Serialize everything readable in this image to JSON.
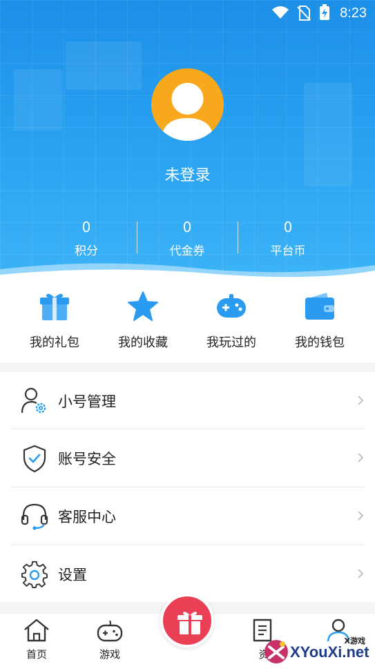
{
  "status_bar": {
    "time": "8:23"
  },
  "profile": {
    "login_status": "未登录"
  },
  "stats": [
    {
      "value": "0",
      "label": "积分"
    },
    {
      "value": "0",
      "label": "代金券"
    },
    {
      "value": "0",
      "label": "平台币"
    }
  ],
  "quick_actions": [
    {
      "label": "我的礼包",
      "icon": "gift-icon"
    },
    {
      "label": "我的收藏",
      "icon": "star-icon"
    },
    {
      "label": "我玩过的",
      "icon": "gamepad-icon"
    },
    {
      "label": "我的钱包",
      "icon": "wallet-icon"
    }
  ],
  "menu": [
    {
      "label": "小号管理",
      "icon": "account-settings-icon"
    },
    {
      "label": "账号安全",
      "icon": "shield-check-icon"
    },
    {
      "label": "客服中心",
      "icon": "headset-icon"
    },
    {
      "label": "设置",
      "icon": "gear-icon"
    }
  ],
  "bottom_nav": [
    {
      "label": "首页",
      "icon": "home-icon"
    },
    {
      "label": "游戏",
      "icon": "controller-icon"
    },
    {
      "label": "",
      "icon": "gift-icon"
    },
    {
      "label": "资",
      "icon": "document-icon"
    },
    {
      "label": "",
      "icon": "profile-icon"
    }
  ],
  "watermark": {
    "small_text": "X游戏",
    "main_text": "XYouXi.net"
  },
  "colors": {
    "header_blue": "#1c8fe8",
    "accent_blue": "#2a9bf0",
    "avatar_orange": "#f7a81d",
    "gift_red": "#ea3f55"
  }
}
